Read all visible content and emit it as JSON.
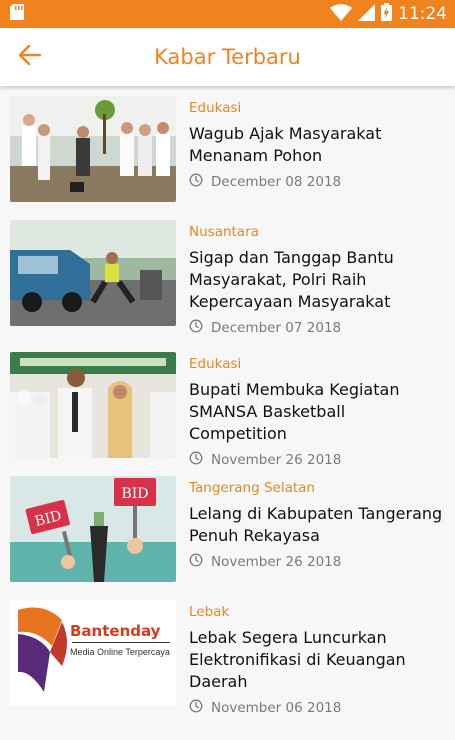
{
  "status": {
    "time": "11:24"
  },
  "header": {
    "title": "Kabar Terbaru"
  },
  "colors": {
    "accent": "#f0831e",
    "category": "#e08a1e"
  },
  "news": [
    {
      "category": "Edukasi",
      "title": "Wagub Ajak Masyarakat Menanam Pohon",
      "date": "December 08 2018"
    },
    {
      "category": "Nusantara",
      "title": "Sigap dan Tanggap Bantu Masyarakat, Polri Raih Kepercayaan Masyarakat",
      "date": "December 07 2018"
    },
    {
      "category": "Edukasi",
      "title": "Bupati Membuka Kegiatan SMANSA Basketball Competition",
      "date": "November 26 2018"
    },
    {
      "category": "Tangerang Selatan",
      "title": "Lelang di Kabupaten Tangerang Penuh Rekayasa",
      "date": "November 26 2018"
    },
    {
      "category": "Lebak",
      "title": "Lebak Segera Luncurkan Elektronifikasi di Keuangan Daerah",
      "date": "November 06 2018"
    }
  ],
  "thumbnails": {
    "bid_sign_left": "BID",
    "bid_sign_right": "BID",
    "logo_name": "Bantenday",
    "logo_tagline": "Media Online Terpercaya"
  }
}
